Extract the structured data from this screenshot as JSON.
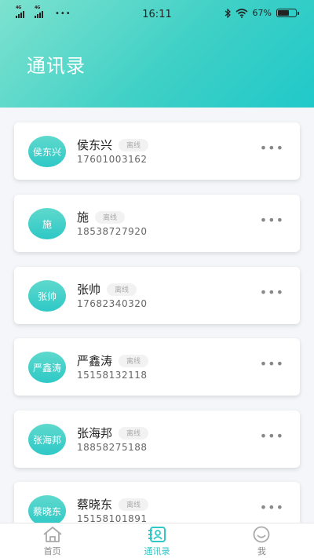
{
  "status_bar": {
    "signal1": "4G",
    "signal2": "4G",
    "dots": "•••",
    "time": "16:11",
    "battery": "67%"
  },
  "header": {
    "title": "通讯录"
  },
  "contacts": [
    {
      "avatar_text": "侯东兴",
      "name": "侯东兴",
      "status": "离线",
      "phone": "17601003162"
    },
    {
      "avatar_text": "施",
      "name": "施",
      "status": "离线",
      "phone": "18538727920"
    },
    {
      "avatar_text": "张帅",
      "name": "张帅",
      "status": "离线",
      "phone": "17682340320"
    },
    {
      "avatar_text": "严鑫涛",
      "name": "严鑫涛",
      "status": "离线",
      "phone": "15158132118"
    },
    {
      "avatar_text": "张海邦",
      "name": "张海邦",
      "status": "离线",
      "phone": "18858275188"
    },
    {
      "avatar_text": "蔡晓东",
      "name": "蔡晓东",
      "status": "离线",
      "phone": "15158101891"
    }
  ],
  "more_label": "•••",
  "tabs": [
    {
      "label": "首页",
      "icon": "home-icon"
    },
    {
      "label": "通讯录",
      "icon": "contacts-icon"
    },
    {
      "label": "我",
      "icon": "smile-icon"
    }
  ],
  "colors": {
    "accent": "#2ec8c6",
    "header_start": "#7ee2cf",
    "header_end": "#20c9c9"
  }
}
